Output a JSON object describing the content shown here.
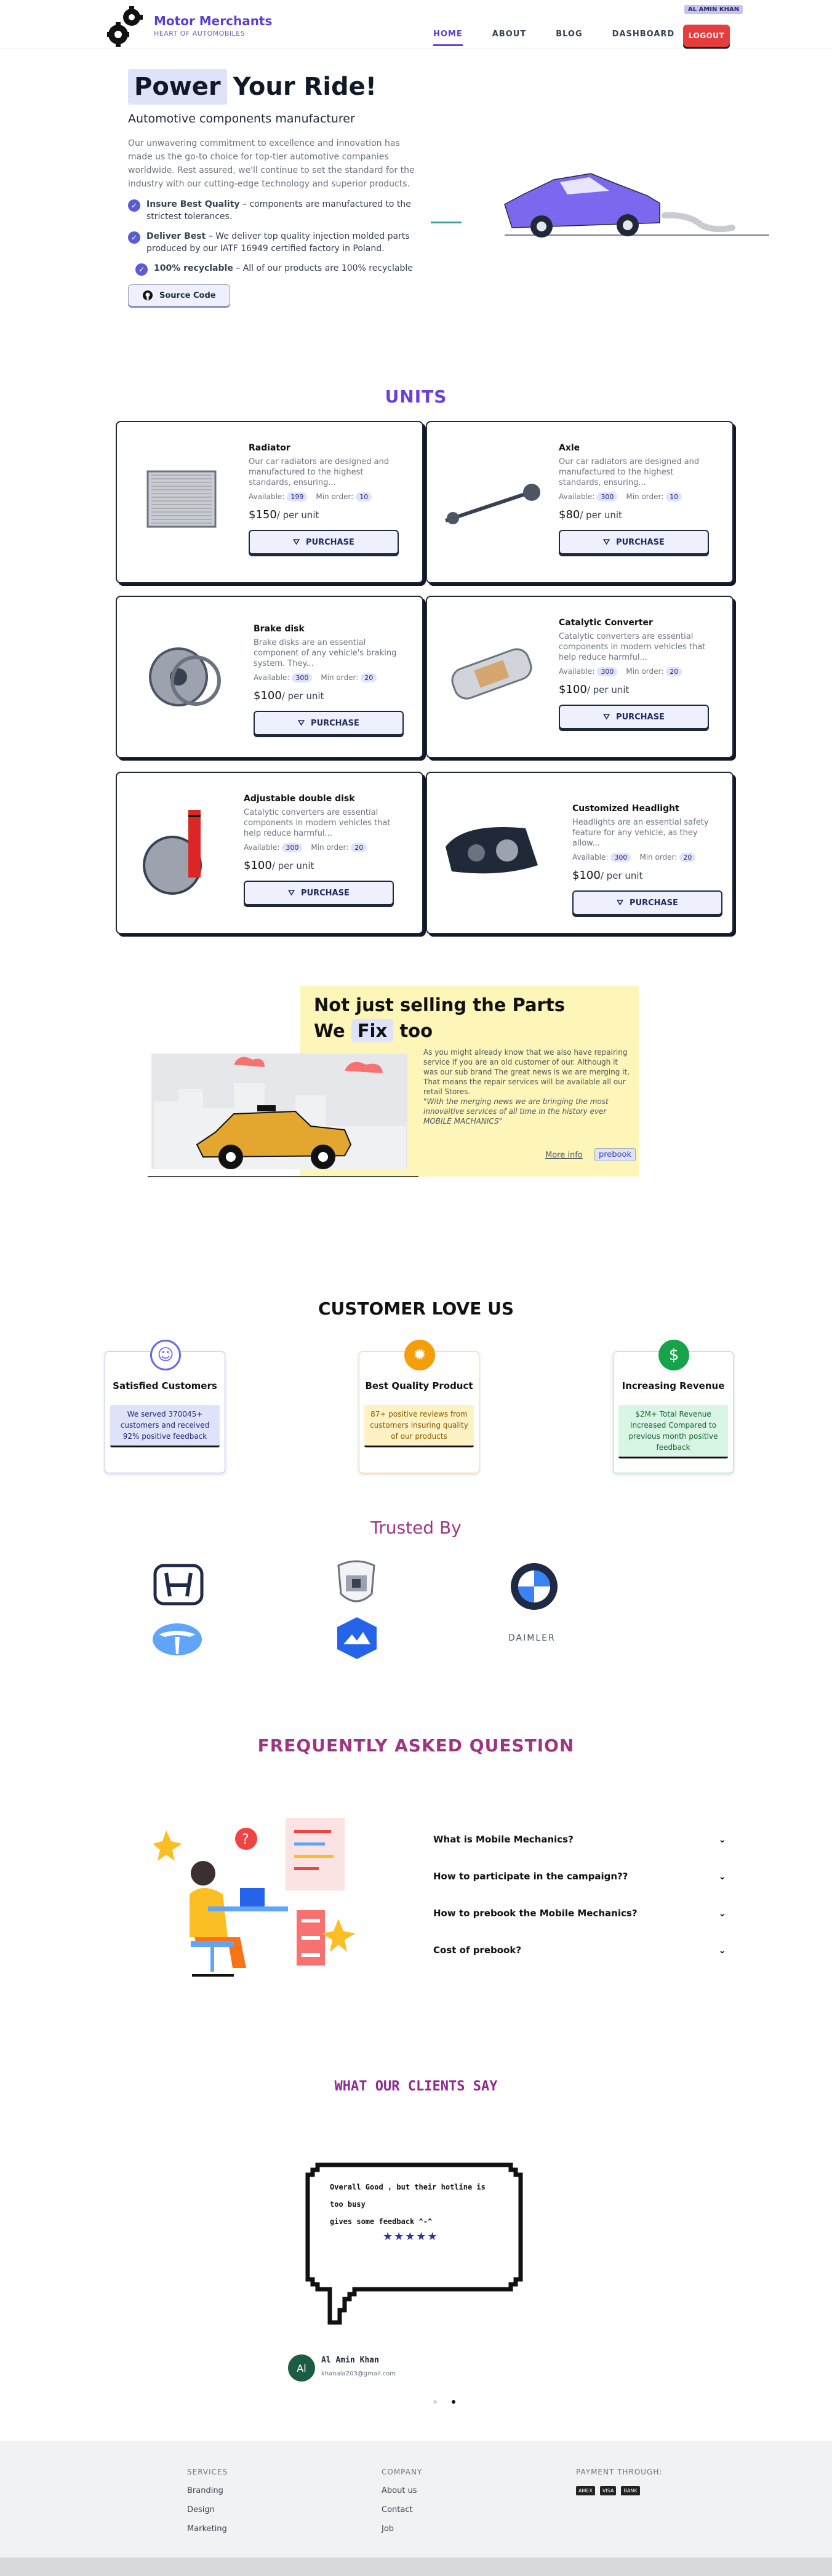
{
  "header": {
    "brand_title": "Motor Merchants",
    "brand_subtitle": "HEART OF AUTOMOBILES",
    "nav": [
      "HOME",
      "ABOUT",
      "BLOG",
      "DASHBOARD"
    ],
    "user": "AL AMIN KHAN",
    "logout": "LOGOUT"
  },
  "hero": {
    "title_highlight": "Power",
    "title_rest": "Your Ride!",
    "subtitle": "Automotive components manufacturer",
    "description": "Our unwavering commitment to excellence and innovation has made us the go-to choice for top-tier automotive companies worldwide. Rest assured, we'll continue to set the standard for the industry with our cutting-edge technology and superior products.",
    "features": [
      {
        "bold": "Insure Best Quality",
        "text": " – components are manufactured to the strictest tolerances."
      },
      {
        "bold": "Deliver Best",
        "text": " – We deliver top quality injection molded parts produced by our IATF 16949 certified factory in Poland."
      },
      {
        "bold": "100% recyclable",
        "text": " – All of our products are 100% recyclable"
      }
    ],
    "source_button": "Source Code"
  },
  "units": {
    "title": "UNITS",
    "available_label": "Available:",
    "min_label": "Min order:",
    "per_unit": "/ per unit",
    "purchase": "PURCHASE",
    "items": [
      {
        "name": "Radiator",
        "desc": "Our car radiators are designed and manufactured to the highest standards, ensuring...",
        "available": "199",
        "min": "10",
        "price": "$150"
      },
      {
        "name": "Axle",
        "desc": "Our car radiators are designed and manufactured to the highest standards, ensuring...",
        "available": "300",
        "min": "10",
        "price": "$80"
      },
      {
        "name": "Brake disk",
        "desc": "Brake disks are an essential component of any vehicle's braking system. They...",
        "available": "300",
        "min": "20",
        "price": "$100"
      },
      {
        "name": "Catalytic Converter",
        "desc": "Catalytic converters are essential components in modern vehicles that help reduce harmful...",
        "available": "300",
        "min": "20",
        "price": "$100"
      },
      {
        "name": "Adjustable double disk",
        "desc": "Catalytic converters are essential components in modern vehicles that help reduce harmful...",
        "available": "300",
        "min": "20",
        "price": "$100"
      },
      {
        "name": "Customized Headlight",
        "desc": "Headlights are an essential safety feature for any vehicle, as they allow...",
        "available": "300",
        "min": "20",
        "price": "$100"
      }
    ]
  },
  "repair": {
    "line1": "Not just selling the Parts",
    "line2_a": "We",
    "line2_fix": "Fix",
    "line2_b": "too",
    "para": "As you might already know that we also have repairing service if you are an old customer of our. Although it was our sub brand The great news is we are merging it, That means the repair services will be available all our retail Stores.",
    "quote": "\"With the merging news we are bringing the most innovaitive services of all time in the history ever MOBILE MACHANICS\"",
    "more": "More info",
    "prebook": "prebook"
  },
  "love": {
    "title": "CUSTOMER LOVE US",
    "cards": [
      {
        "title": "Satisfied Customers",
        "text": "We served 370045+ customers and received 92% positive feedback"
      },
      {
        "title": "Best Quality Product",
        "text": "87+ positive reviews from customers insuring quality of our products"
      },
      {
        "title": "Increasing Revenue",
        "text": "$2M+ Total Revenue Increased Compared to previous month positive feedback"
      }
    ]
  },
  "trusted": {
    "title": "Trusted By",
    "daimler": "DAIMLER"
  },
  "faq": {
    "title": "FREQUENTLY ASKED QUESTION",
    "questions": [
      "What is Mobile Mechanics?",
      "How to participate in the campaign??",
      "How to prebook the Mobile Mechanics?",
      "Cost of prebook?"
    ]
  },
  "testimonials": {
    "title": "WHAT OUR CLIENTS SAY",
    "quote_l1": "Overall Good , but their hotline is",
    "quote_l2": "too busy",
    "quote_l3": "gives some feedback ^-^",
    "stars": "★★★★★",
    "initials": "Al",
    "name": "Al Amin Khan",
    "email": "khanala203@gmail.com"
  },
  "footer": {
    "services": {
      "heading": "SERVICES",
      "links": [
        "Branding",
        "Design",
        "Marketing"
      ]
    },
    "company": {
      "heading": "COMPANY",
      "links": [
        "About us",
        "Contact",
        "Job"
      ]
    },
    "payment": {
      "heading": "PAYMENT THROUGH:",
      "cards": [
        "AMEX",
        "VISA",
        "BANK"
      ]
    }
  }
}
